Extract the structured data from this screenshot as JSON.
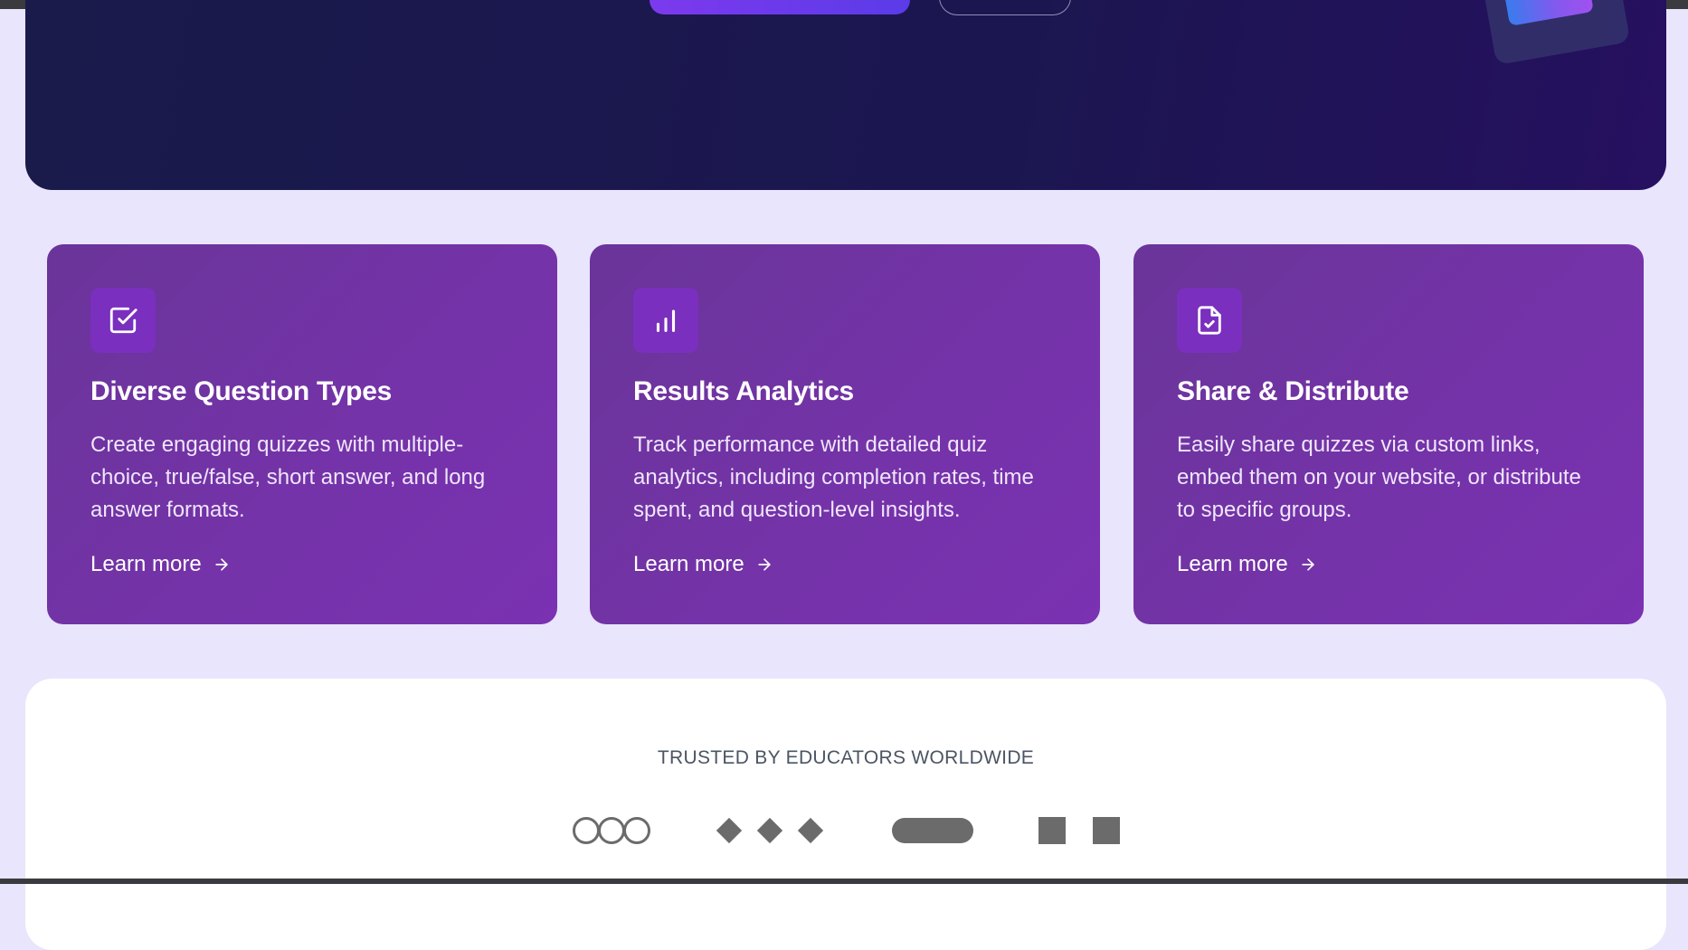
{
  "features": [
    {
      "icon": "checkbox-icon",
      "title": "Diverse Question Types",
      "description": "Create engaging quizzes with multiple-choice, true/false, short answer, and long answer formats.",
      "link": "Learn more"
    },
    {
      "icon": "bar-chart-icon",
      "title": "Results Analytics",
      "description": "Track performance with detailed quiz analytics, including completion rates, time spent, and question-level insights.",
      "link": "Learn more"
    },
    {
      "icon": "file-check-icon",
      "title": "Share & Distribute",
      "description": "Easily share quizzes via custom links, embed them on your website, or distribute to specific groups.",
      "link": "Learn more"
    }
  ],
  "trusted": {
    "label": "TRUSTED BY EDUCATORS WORLDWIDE",
    "logos": [
      "three-circles-logo",
      "three-diamonds-logo",
      "pill-logo",
      "two-squares-logo"
    ]
  },
  "colors": {
    "page_bg": "#e8e5fc",
    "hero_bg": "#1b1650",
    "card_bg": "#7433a8",
    "icon_box": "#7a2fbf",
    "logo_gray": "#6b6b6b"
  }
}
